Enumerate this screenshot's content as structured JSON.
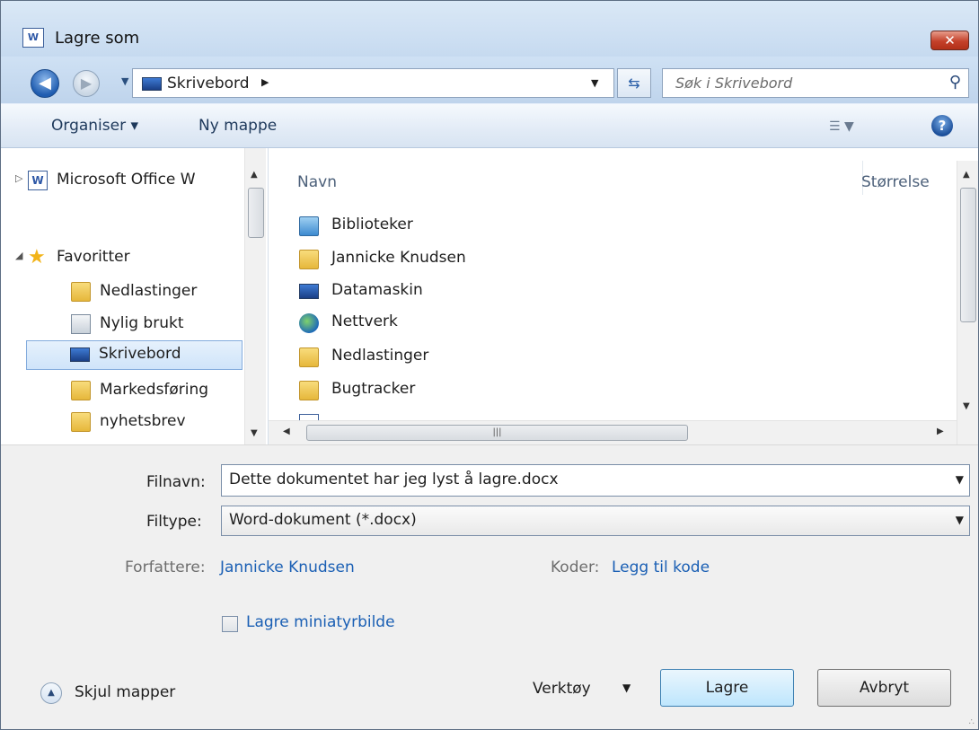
{
  "window": {
    "title": "Lagre som",
    "app_icon_text": "W",
    "close_label": "✕"
  },
  "nav": {
    "address": "Skrivebord",
    "search_placeholder": "Søk i Skrivebord"
  },
  "toolbar": {
    "organize_label": "Organiser ▾",
    "new_folder_label": "Ny mappe"
  },
  "sidebar": {
    "items": [
      {
        "label": "Microsoft Office W",
        "icon": "office-word-icon"
      },
      {
        "label": "Favoritter",
        "icon": "star-icon"
      },
      {
        "label": "Nedlastinger",
        "icon": "downloads-folder-icon"
      },
      {
        "label": "Nylig brukt",
        "icon": "recent-places-icon"
      },
      {
        "label": "Skrivebord",
        "icon": "desktop-icon",
        "selected": true
      },
      {
        "label": "Markedsføring",
        "icon": "folder-icon"
      },
      {
        "label": "nyhetsbrev",
        "icon": "folder-icon"
      }
    ]
  },
  "filelist": {
    "columns": {
      "name": "Navn",
      "size": "Størrelse"
    },
    "items": [
      {
        "label": "Biblioteker",
        "icon": "libraries-icon"
      },
      {
        "label": "Jannicke Knudsen",
        "icon": "user-folder-icon"
      },
      {
        "label": "Datamaskin",
        "icon": "computer-icon"
      },
      {
        "label": "Nettverk",
        "icon": "network-icon"
      },
      {
        "label": "Nedlastinger",
        "icon": "folder-icon"
      },
      {
        "label": "Bugtracker",
        "icon": "folder-icon"
      }
    ]
  },
  "form": {
    "filename_label": "Filnavn:",
    "filename_value": "Dette dokumentet har jeg lyst å lagre.docx",
    "filetype_label": "Filtype:",
    "filetype_value": "Word-dokument (*.docx)",
    "authors_label": "Forfattere:",
    "authors_value": "Jannicke Knudsen",
    "tags_label": "Koder:",
    "tags_value": "Legg til kode",
    "thumbnail_label": "Lagre miniatyrbilde"
  },
  "footer": {
    "hide_folders_label": "Skjul mapper",
    "tools_label": "Verktøy",
    "save_label": "Lagre",
    "cancel_label": "Avbryt"
  },
  "colors": {
    "accent": "#1a5fb4",
    "selection": "#cfe4fa",
    "close": "#c4412a"
  }
}
